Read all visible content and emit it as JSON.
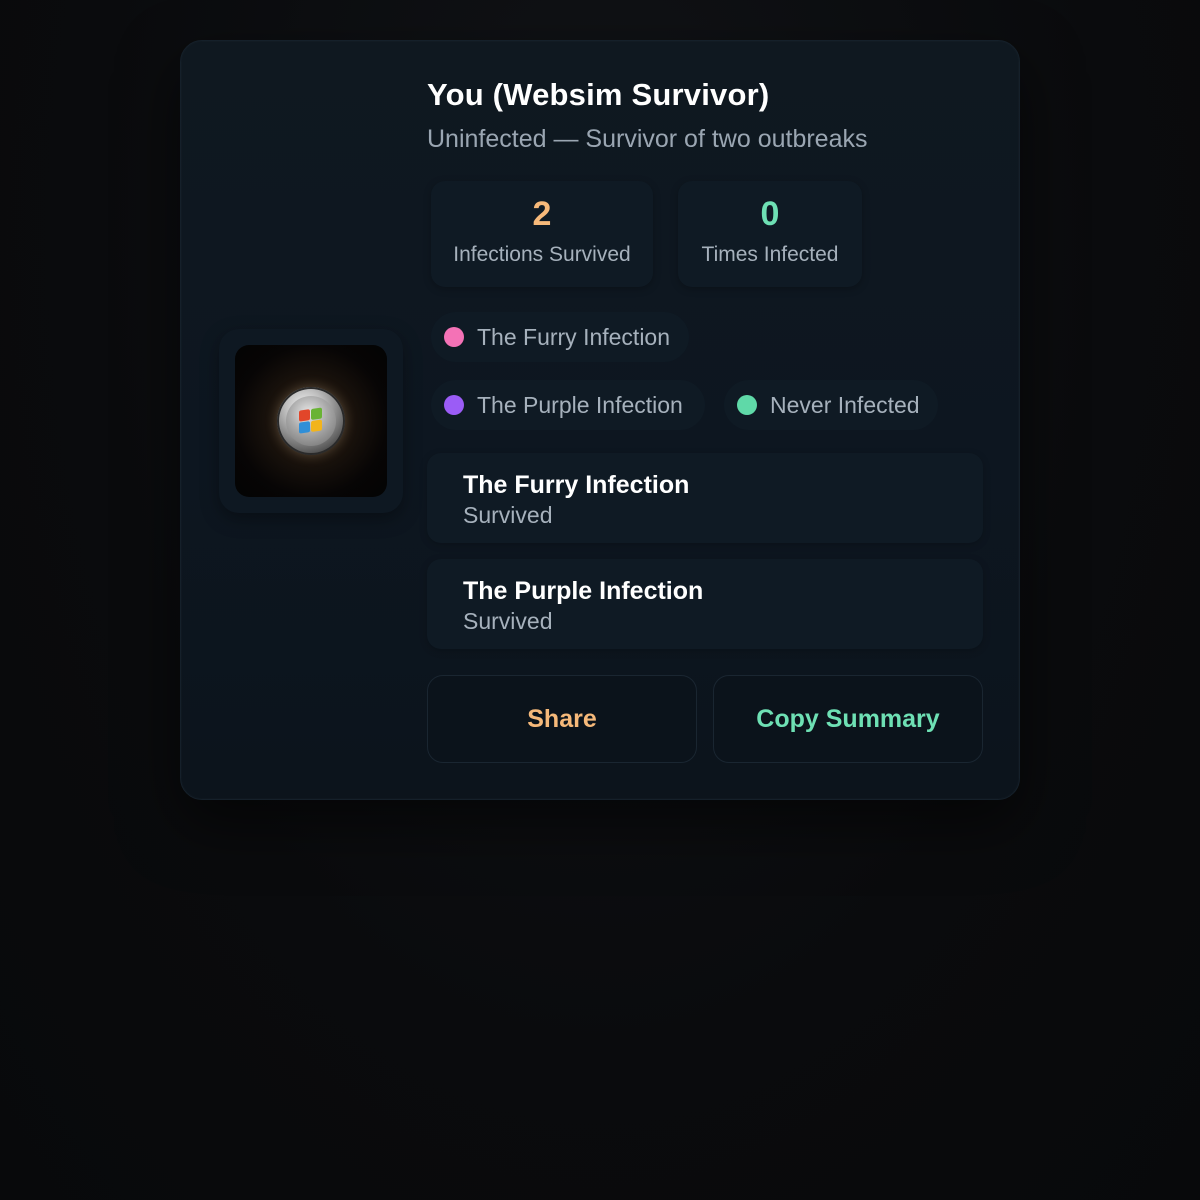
{
  "profile": {
    "name": "You (Websim Survivor)",
    "status": "Uninfected — Survivor of two outbreaks",
    "avatar_icon": "windows-orb-icon"
  },
  "stats": [
    {
      "value": "2",
      "label": "Infections Survived",
      "color": "#f6b97a"
    },
    {
      "value": "0",
      "label": "Times Infected",
      "color": "#6ee0b4"
    }
  ],
  "tags": [
    {
      "label": "The Furry Infection",
      "color": "#f472b6"
    },
    {
      "label": "The Purple Infection",
      "color": "#9b5cf6"
    },
    {
      "label": "Never Infected",
      "color": "#5fd9a8"
    }
  ],
  "history": [
    {
      "title": "The Furry Infection",
      "status": "Survived"
    },
    {
      "title": "The Purple Infection",
      "status": "Survived"
    }
  ],
  "actions": {
    "share_label": "Share",
    "share_color": "#f6b97a",
    "copy_label": "Copy Summary",
    "copy_color": "#6ee0b4"
  }
}
